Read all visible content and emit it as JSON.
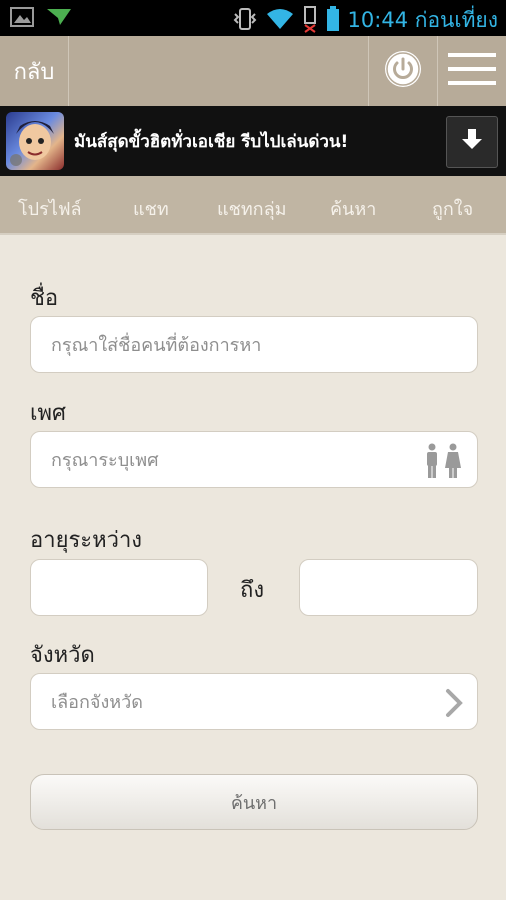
{
  "status_bar": {
    "time": "10:44 ก่อนเที่ยง"
  },
  "header": {
    "back_label": "กลับ",
    "power_icon": "power-icon",
    "menu_icon": "hamburger-menu-icon"
  },
  "ad": {
    "text": "มันส์สุดขั้วฮิตทั่วเอเชีย รีบไปเล่นด่วน!",
    "download_icon": "download-arrow-icon"
  },
  "tabs": [
    {
      "label": "โปรไฟล์"
    },
    {
      "label": "แชท"
    },
    {
      "label": "แชทกลุ่ม"
    },
    {
      "label": "ค้นหา"
    },
    {
      "label": "ถูกใจ"
    }
  ],
  "form": {
    "name_label": "ชื่อ",
    "name_placeholder": "กรุณาใส่ชื่อคนที่ต้องการหา",
    "gender_label": "เพศ",
    "gender_placeholder": "กรุณาระบุเพศ",
    "gender_icon": "gender-icon",
    "age_label": "อายุระหว่าง",
    "age_to_label": "ถึง",
    "province_label": "จังหวัด",
    "province_placeholder": "เลือกจังหวัด",
    "province_icon": "chevron-right-icon",
    "search_button": "ค้นหา"
  },
  "colors": {
    "header_bg": "#b7ab99",
    "tab_bg": "#c0b5a3",
    "page_bg": "#ece7dd",
    "status_accent": "#33b5e5"
  }
}
